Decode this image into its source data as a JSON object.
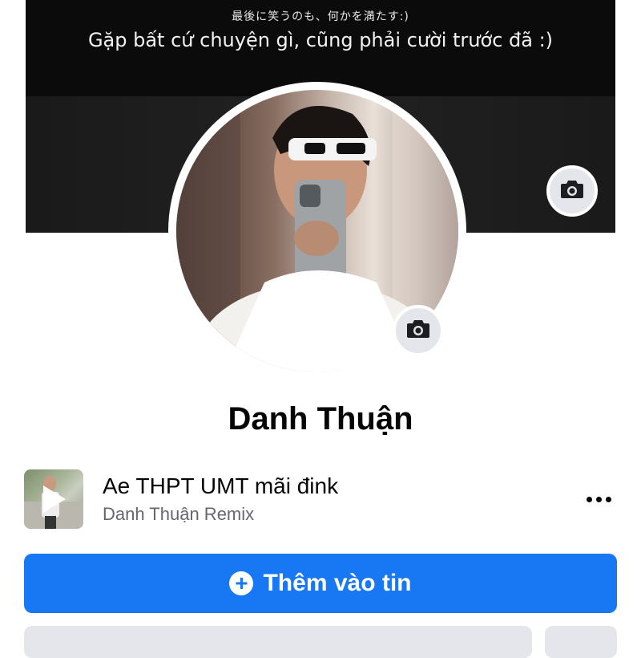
{
  "cover": {
    "line1": "最後に笑うのも、何かを満たす:)",
    "line2": "Gặp bất cứ chuyện gì, cũng phải cười trước đã :)",
    "camera_icon": "camera-icon"
  },
  "profile": {
    "name": "Danh Thuận",
    "avatar_camera_icon": "camera-icon"
  },
  "music": {
    "title": "Ae THPT UMT mãi đink",
    "artist": "Danh Thuận Remix",
    "play_icon": "play-icon",
    "more_icon": "more-icon"
  },
  "actions": {
    "add_story_label": "Thêm vào tin",
    "add_story_icon": "plus-circle-icon",
    "primary_color": "#1877f2"
  }
}
